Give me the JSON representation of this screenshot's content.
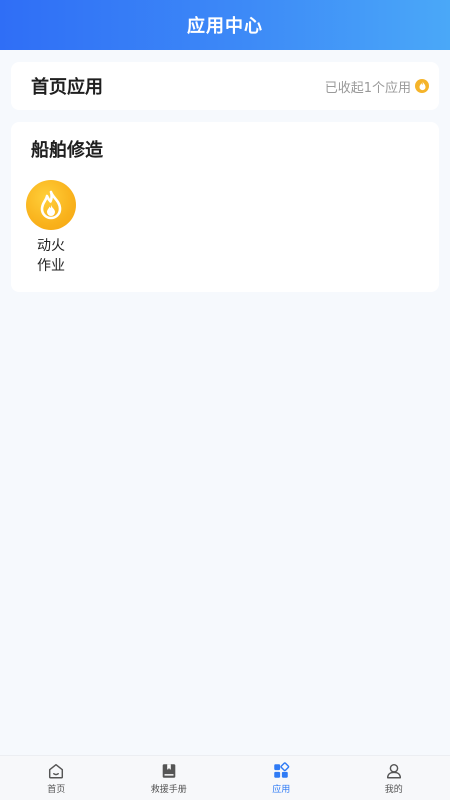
{
  "header": {
    "title": "应用中心"
  },
  "home_apps": {
    "title": "首页应用",
    "collapse_text": "已收起1个应用",
    "collapse_icon": "fire-small-icon"
  },
  "ship_repair": {
    "title": "船舶修造",
    "apps": [
      {
        "label": "动火作业",
        "icon": "fire-icon",
        "color": "#f9b21c"
      }
    ]
  },
  "tabbar": {
    "items": [
      {
        "label": "首页",
        "icon": "home-icon",
        "active": false
      },
      {
        "label": "救援手册",
        "icon": "book-icon",
        "active": false
      },
      {
        "label": "应用",
        "icon": "apps-icon",
        "active": true
      },
      {
        "label": "我的",
        "icon": "user-icon",
        "active": false
      }
    ],
    "active_color": "#2f7bf5"
  }
}
